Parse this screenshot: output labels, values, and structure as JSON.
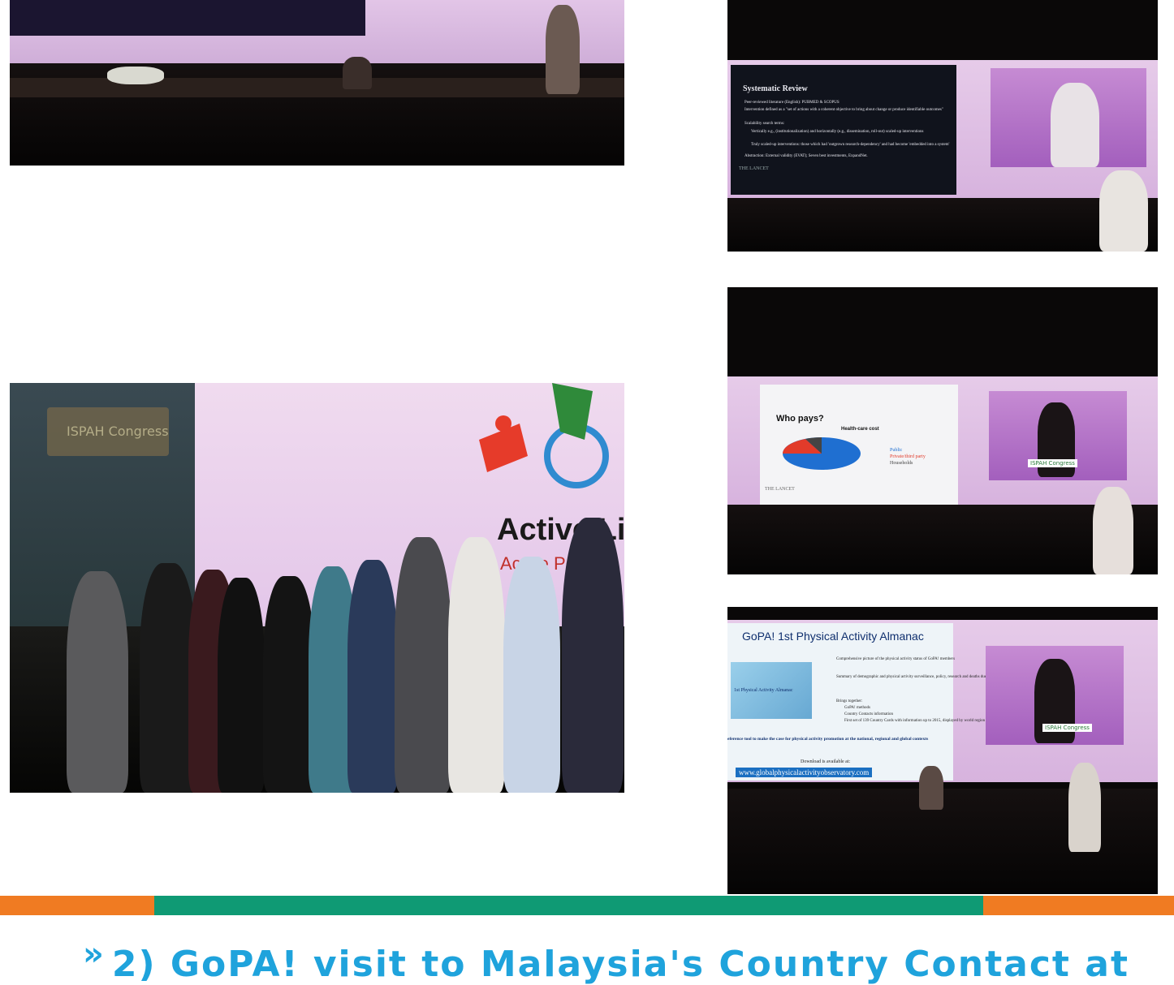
{
  "photos": {
    "p1": {
      "alt": "Speaker presenting on stage with panel table"
    },
    "p2": {
      "slide_title": "Systematic Review",
      "bullets": [
        "Peer-reviewed literature (English): PUBMED & SCOPUS",
        "Intervention defined as a \"set of actions with a coherent objective to bring about change or produce identifiable outcomes\"",
        "Scalability search terms:",
        "Vertically e.g., (institutionalization) and horizontally (e.g., dissemination, roll-out) scaled-up interventions",
        "Truly scaled-up interventions: those which had 'outgrown research-dependency' and had become 'embedded into a system'",
        "Abstraction: External validity (EVAT); Seven best investments, ExpandNet."
      ],
      "footer": "THE LANCET"
    },
    "p3": {
      "slide_title": "Who pays?",
      "chart_label": "Health-care cost",
      "legend": [
        "Public",
        "Private/third party",
        "Households"
      ],
      "footer": "THE LANCET",
      "logo": "ISPAH Congress"
    },
    "p4": {
      "slide_title": "GoPA! 1st Physical Activity Almanac",
      "bullets": [
        "Comprehensive picture of the physical activity status of GoPA! members",
        "Summary of demographic and physical activity surveillance, policy, research and deaths due to physical inactivity indicators",
        "Brings together:",
        "GoPA! methods",
        "Country Contacts information",
        "First set of 139 Country Cards with information up to 2015, displayed by world region"
      ],
      "book_label": "1st Physical Activity Almanac",
      "tagline": "eference tool to make the case for physical activity promotion at the national, regional and global contexts",
      "download": "Download is available at:",
      "url": "www.globalphysicalactivityobservatory.com"
    },
    "p5": {
      "banner_text": "Active Li",
      "banner_sub": "Active Peo",
      "logo": "ISPAH Congress"
    }
  },
  "colors": {
    "orange": "#f07b22",
    "green": "#0f9a74",
    "heading": "#1fa3dc"
  },
  "section": {
    "arrow": "»",
    "heading": "2) GoPA! visit to Malaysia's Country Contact at"
  }
}
